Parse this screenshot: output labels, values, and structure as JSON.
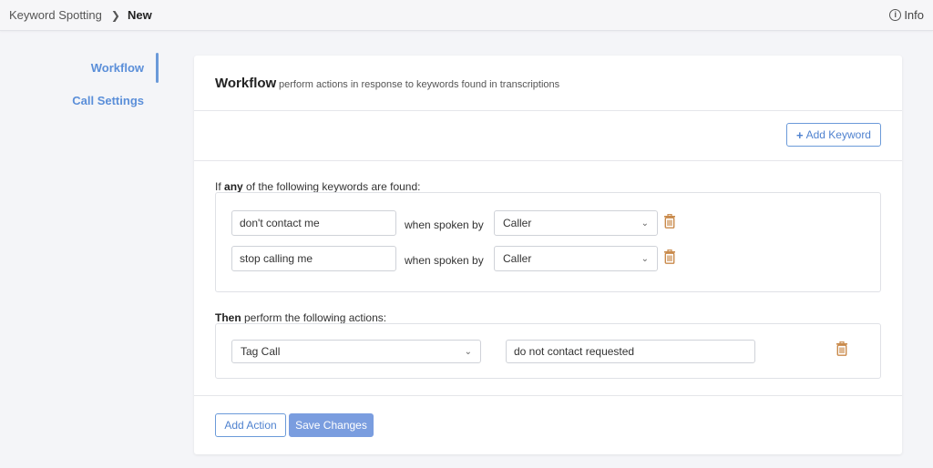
{
  "breadcrumb": {
    "parent": "Keyword Spotting",
    "current": "New"
  },
  "header": {
    "info_label": "Info"
  },
  "sidenav": {
    "items": [
      {
        "label": "Workflow",
        "active": true
      },
      {
        "label": "Call Settings",
        "active": false
      }
    ]
  },
  "card": {
    "title": "Workflow",
    "subtitle": "perform actions in response to keywords found in transcriptions",
    "add_keyword_label": "Add Keyword",
    "keywords_label_pre": "If ",
    "keywords_label_bold": "any",
    "keywords_label_post": " of the following keywords are found:",
    "keywords": [
      {
        "value": "don't contact me",
        "spoken_by_label": "when spoken by",
        "speaker": "Caller"
      },
      {
        "value": "stop calling me",
        "spoken_by_label": "when spoken by",
        "speaker": "Caller"
      }
    ],
    "actions_label_bold": "Then",
    "actions_label_post": " perform the following actions:",
    "actions": [
      {
        "type": "Tag Call",
        "value": "do not contact requested"
      }
    ],
    "add_action_label": "Add Action",
    "save_label": "Save Changes"
  },
  "colors": {
    "accent": "#5b8fd9",
    "trash": "#c98a4b",
    "save_bg": "#7a9ddf"
  },
  "icons": {
    "chevron": "chevron-right-icon",
    "info": "info-icon",
    "trash": "trash-icon",
    "dropdown": "chevron-down-icon",
    "plus": "plus-icon"
  }
}
